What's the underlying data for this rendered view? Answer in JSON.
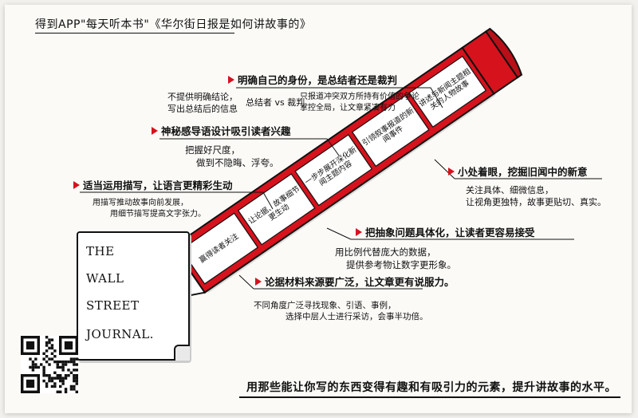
{
  "title": "得到APP\"每天听本书\"《华尔街日报是如何讲故事的》",
  "pencil": {
    "colors": {
      "red": "#d6121d",
      "white": "#ffffff",
      "outline": "#111111"
    },
    "segments": [
      "赢得读者关注",
      "让论据、故事细节更生动",
      "一步步展开深化新闻主题内容",
      "引领叙事报道的新闻事件",
      "讲述与新闻主题相关的人物故事"
    ]
  },
  "nodes": {
    "identity": {
      "heading": "明确自己的身份，是总结者还是裁判",
      "left_note": [
        "不提供明确结论，",
        "写出总结后的信息"
      ],
      "mid_note": "总结者 vs 裁判",
      "right_note": [
        "只报道冲突双方所持有价值的争论",
        "掌控全局，让文章紧凑有力"
      ]
    },
    "mystery": {
      "heading": "神秘感导语设计吸引读者兴趣",
      "note": [
        "把握好尺度，",
        "做到不隐晦、浮夸。"
      ]
    },
    "description": {
      "heading": "适当运用描写，让语言更精彩生动",
      "note": [
        "用描写推动故事向前发展，",
        "用细节描写提高文字张力。"
      ]
    },
    "detail": {
      "heading": "小处着眼，挖掘旧闻中的新意",
      "note": [
        "关注具体、细微信息，",
        "让视角更独特，故事更贴切、真实。"
      ]
    },
    "abstract": {
      "heading": "把抽象问题具体化，让读者更容易接受",
      "note": [
        "用比例代替庞大的数据，",
        "提供参考物让数字更形象。"
      ]
    },
    "evidence": {
      "heading": "论据材料来源要广泛，让文章更有说服力。",
      "note": [
        "不同角度广泛寻找现象、引语、事例，",
        "选择中层人士进行采访，会事半功倍。"
      ]
    }
  },
  "journal": {
    "lines": [
      "THE",
      "WALL",
      "STREET",
      "JOURNAL."
    ]
  },
  "bottom_note": "用那些能让你写的东西变得有趣和有吸引力的元素，提升讲故事的水平。"
}
